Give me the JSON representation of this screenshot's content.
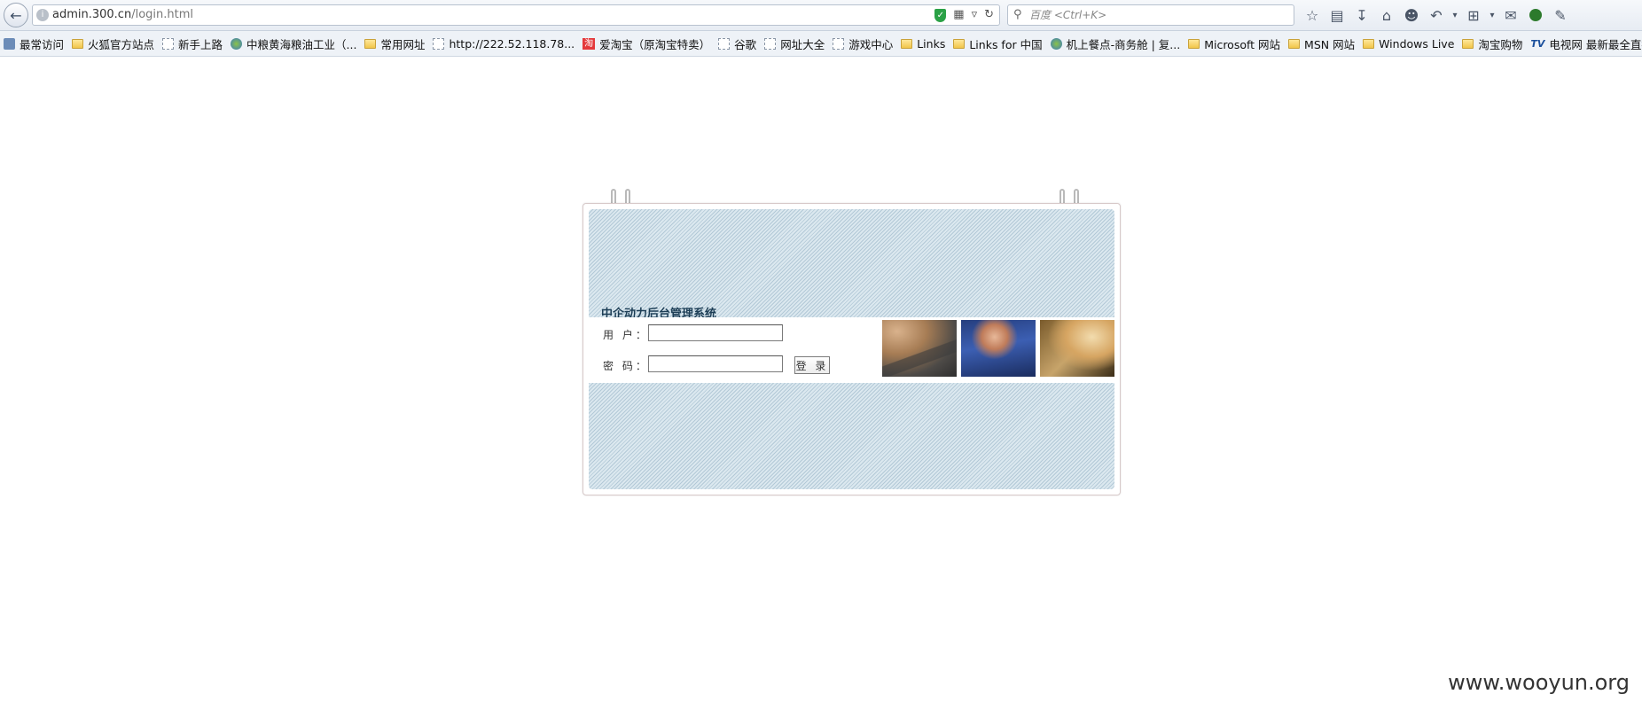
{
  "browser": {
    "url_host": "admin.300.cn",
    "url_path": "/login.html",
    "search_placeholder": "百度 <Ctrl+K>"
  },
  "bookmarks": [
    {
      "label": "最常访问",
      "icon": "special"
    },
    {
      "label": "火狐官方站点",
      "icon": "folder"
    },
    {
      "label": "新手上路",
      "icon": "page"
    },
    {
      "label": "中粮黄海粮油工业（...",
      "icon": "globe"
    },
    {
      "label": "常用网址",
      "icon": "folder"
    },
    {
      "label": "http://222.52.118.78...",
      "icon": "page"
    },
    {
      "label": "爱淘宝（原淘宝特卖）",
      "icon": "taobao"
    },
    {
      "label": "谷歌",
      "icon": "page"
    },
    {
      "label": "网址大全",
      "icon": "page"
    },
    {
      "label": "游戏中心",
      "icon": "page"
    },
    {
      "label": "Links",
      "icon": "folder"
    },
    {
      "label": "Links for 中国",
      "icon": "folder"
    },
    {
      "label": "机上餐点-商务舱 | 复...",
      "icon": "globe"
    },
    {
      "label": "Microsoft 网站",
      "icon": "folder"
    },
    {
      "label": "MSN 网站",
      "icon": "folder"
    },
    {
      "label": "Windows Live",
      "icon": "folder"
    },
    {
      "label": "淘宝购物",
      "icon": "folder"
    },
    {
      "label": "电视网 最新最全直播...",
      "icon": "tv"
    }
  ],
  "login": {
    "system_title": "中企动力后台管理系统",
    "username_label": "用 户：",
    "password_label": "密 码：",
    "username_value": "",
    "password_value": "",
    "login_button": "登 录"
  },
  "watermark": "www.wooyun.org"
}
